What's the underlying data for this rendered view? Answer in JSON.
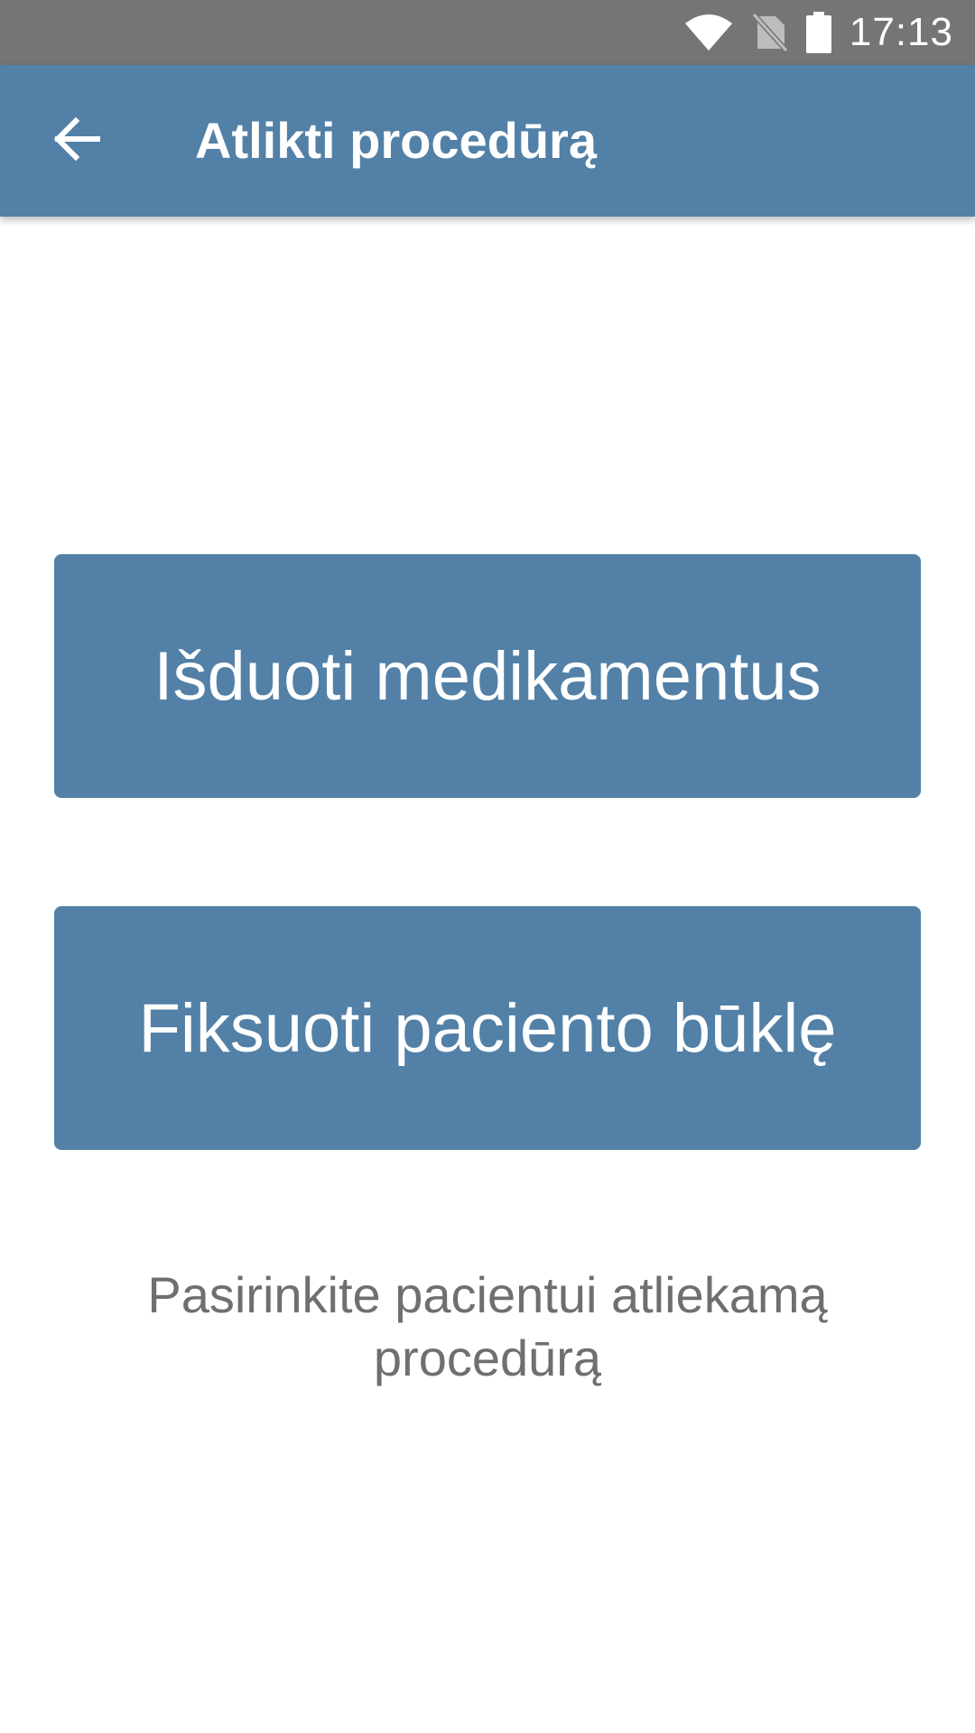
{
  "status_bar": {
    "time": "17:13",
    "icons": [
      "wifi-icon",
      "no-sim-icon",
      "battery-icon"
    ],
    "background": "#757575"
  },
  "app_bar": {
    "title": "Atlikti procedūrą",
    "back_icon": "arrow-left-icon",
    "background": "#5280a7"
  },
  "actions": {
    "dispense_label": "Išduoti medikamentus",
    "record_label": "Fiksuoti paciento būklę",
    "button_color": "#5280a7"
  },
  "hint": {
    "text": "Pasirinkite pacientui atliekamą procedūrą"
  }
}
